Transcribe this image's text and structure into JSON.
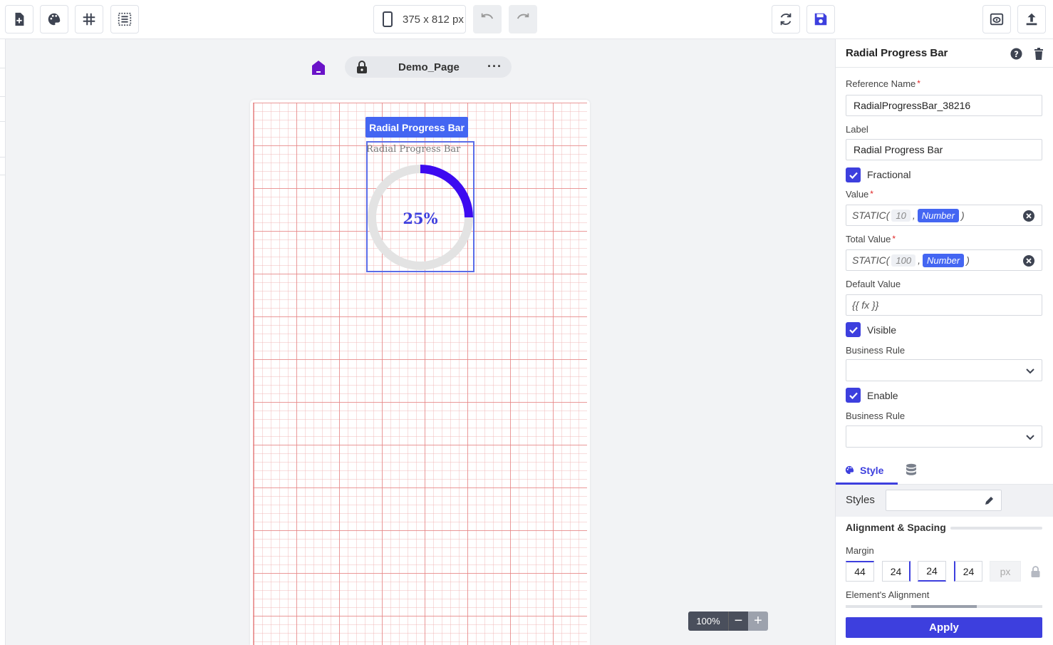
{
  "toolbar": {
    "device_size": "375 x 812 px"
  },
  "page": {
    "name": "Demo_Page"
  },
  "component": {
    "tag": "Radial Progress Bar",
    "label": "Radial Progress Bar",
    "percent_text": "25%",
    "progress_fraction": 0.25,
    "progress_color": "#3d0af0",
    "track_color": "#e3e3e3"
  },
  "zoom": {
    "level": "100%",
    "minus": "−",
    "plus": "+"
  },
  "panel": {
    "title": "Radial Progress Bar",
    "reference_name_label": "Reference Name",
    "reference_name_value": "RadialProgressBar_38216",
    "label_label": "Label",
    "label_value": "Radial Progress Bar",
    "fractional_label": "Fractional",
    "value_label": "Value",
    "value_expr": {
      "prefix": "STATIC(",
      "num": "10",
      "sep": ",",
      "type": "Number",
      "suffix": ")"
    },
    "total_value_label": "Total Value",
    "total_value_expr": {
      "prefix": "STATIC(",
      "num": "100",
      "sep": ",",
      "type": "Number",
      "suffix": ")"
    },
    "default_value_label": "Default Value",
    "default_value_placeholder": "{{ fx }}",
    "visible_label": "Visible",
    "business_rule_label_1": "Business Rule",
    "enable_label": "Enable",
    "business_rule_label_2": "Business Rule",
    "tab_style": "Style",
    "styles_label": "Styles",
    "alignment_spacing": "Alignment & Spacing",
    "margin_label": "Margin",
    "margin": [
      "44",
      "24",
      "24",
      "24"
    ],
    "unit": "px",
    "element_alignment_label": "Element's Alignment",
    "apply": "Apply"
  },
  "colors": {
    "accent": "#3d3fde",
    "tag_blue": "#4466f2",
    "home_purple": "#6a12c8"
  }
}
